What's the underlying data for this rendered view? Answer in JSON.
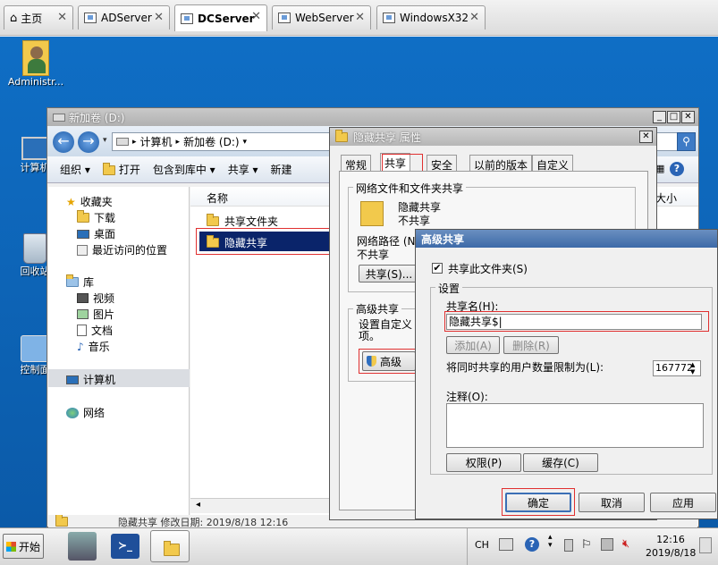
{
  "vm_tabs": [
    {
      "label": "主页"
    },
    {
      "label": "ADServer"
    },
    {
      "label": "DCServer"
    },
    {
      "label": "WebServer"
    },
    {
      "label": "WindowsX32"
    }
  ],
  "desktop_icons": [
    {
      "label": "Administr..."
    },
    {
      "label": "计算机"
    },
    {
      "label": "回收站"
    },
    {
      "label": "控制面"
    }
  ],
  "explorer": {
    "title": "新加卷 (D:)",
    "breadcrumb": [
      "计算机",
      "新加卷 (D:)"
    ],
    "toolbar": [
      "组织 ▾",
      "打开",
      "包含到库中 ▾",
      "共享 ▾",
      "新建"
    ],
    "nav": {
      "favorites": "收藏夹",
      "favorites_items": [
        "下载",
        "桌面",
        "最近访问的位置"
      ],
      "libraries": "库",
      "library_items": [
        "视频",
        "图片",
        "文档",
        "音乐"
      ],
      "computer": "计算机",
      "network": "网络"
    },
    "columns": [
      "名称",
      "大小"
    ],
    "files": [
      "共享文件夹",
      "隐藏共享"
    ],
    "statusbar": "隐藏共享 修改日期: 2019/8/18 12:16"
  },
  "props": {
    "title": "隐藏共享 属性",
    "tabs": [
      "常规",
      "共享",
      "安全",
      "以前的版本",
      "自定义"
    ],
    "group1_label": "网络文件和文件夹共享",
    "folder_name": "隐藏共享",
    "folder_state": "不共享",
    "netpath_label": "网络路径 (N",
    "netpath_value": "不共享",
    "share_button": "共享(S)...",
    "group2_label": "高级共享",
    "group2_desc_1": "设置自定义",
    "group2_desc_2": "项。",
    "advanced_button": "高级"
  },
  "adv": {
    "title": "高级共享",
    "share_checkbox": "共享此文件夹(S)",
    "settings_label": "设置",
    "share_name_label": "共享名(H):",
    "share_name_value": "隐藏共享$|",
    "add_button": "添加(A)",
    "remove_button": "删除(R)",
    "limit_label": "将同时共享的用户数量限制为(L):",
    "limit_value": "167772",
    "comment_label": "注释(O):",
    "comment_value": "",
    "perm_button": "权限(P)",
    "cache_button": "缓存(C)",
    "ok_button": "确定",
    "cancel_button": "取消",
    "apply_button": "应用"
  },
  "taskbar": {
    "start": "开始",
    "lang": "CH",
    "time": "12:16",
    "date": "2019/8/18"
  }
}
